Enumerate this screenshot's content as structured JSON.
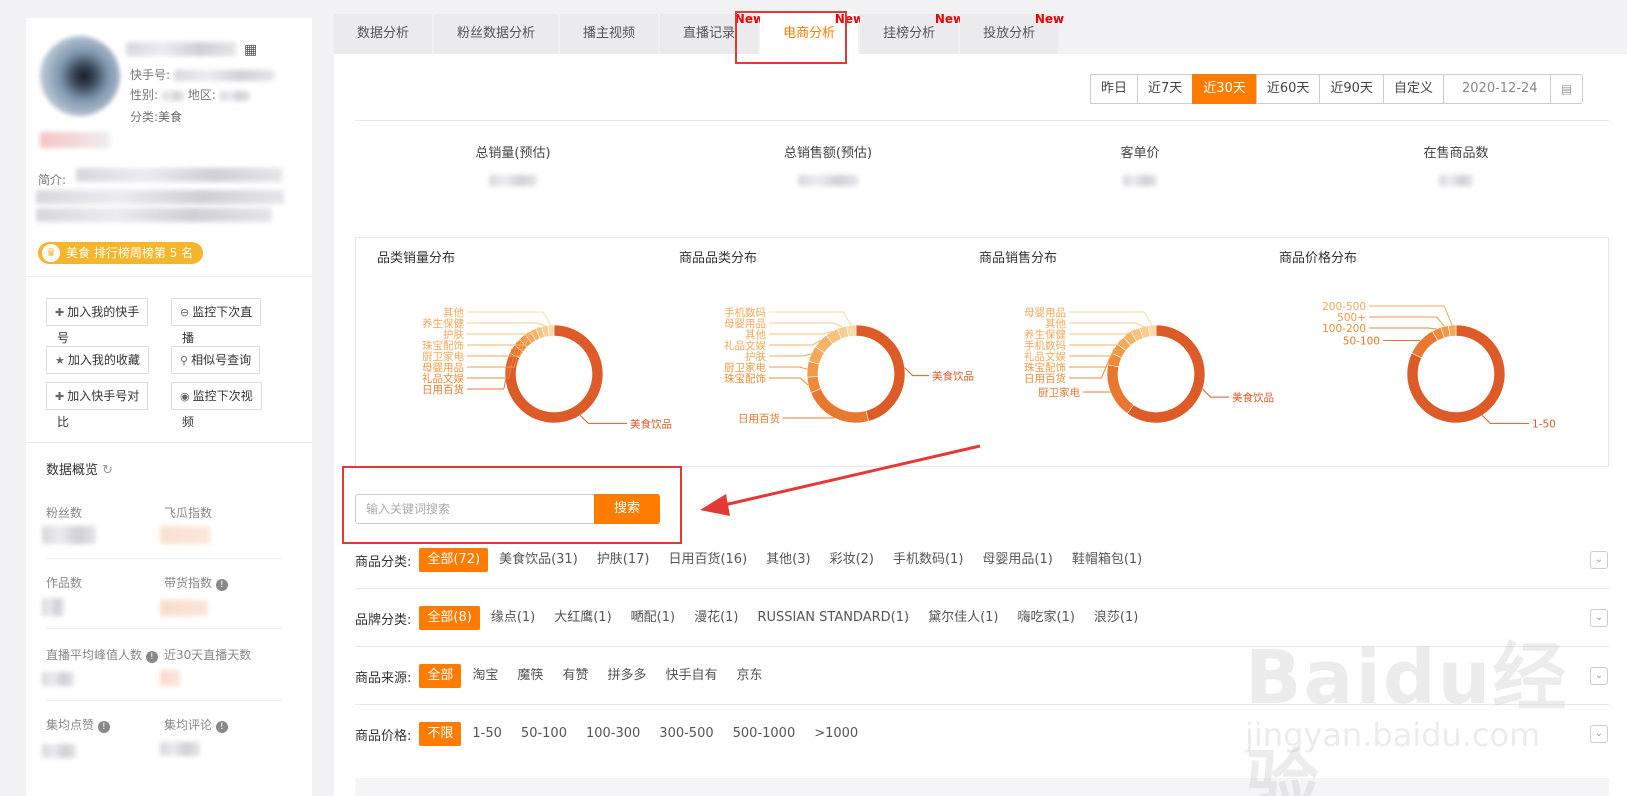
{
  "profile": {
    "kuaishou_label": "快手号:",
    "gender_label": "性别:",
    "region_label": "地区:",
    "category_label": "分类:",
    "category_value": "美食",
    "intro_label": "简介:",
    "rank_badge": "美食 排行榜周榜第 5 名"
  },
  "actions": [
    {
      "icon": "plus-icon",
      "label": "加入我的快手",
      "wrap": "号"
    },
    {
      "icon": "monitor-live-icon",
      "label": "监控下次直",
      "wrap": "播"
    },
    {
      "icon": "star-icon",
      "label": "加入我的收藏",
      "wrap": ""
    },
    {
      "icon": "search-icon",
      "label": "相似号查询",
      "wrap": ""
    },
    {
      "icon": "plus-icon",
      "label": "加入快手号对",
      "wrap": "比"
    },
    {
      "icon": "eye-icon",
      "label": "监控下次视",
      "wrap": "频"
    }
  ],
  "overview": {
    "title": "数据概览",
    "stats": [
      "粉丝数",
      "飞瓜指数",
      "作品数",
      "带货指数",
      "直播平均峰值人数",
      "近30天直播天数",
      "集均点赞",
      "集均评论"
    ]
  },
  "tabs": [
    {
      "label": "数据分析",
      "new": ""
    },
    {
      "label": "粉丝数据分析",
      "new": ""
    },
    {
      "label": "播主视频",
      "new": ""
    },
    {
      "label": "直播记录",
      "new": "New"
    },
    {
      "label": "电商分析",
      "new": "New"
    },
    {
      "label": "挂榜分析",
      "new": "New"
    },
    {
      "label": "投放分析",
      "new": "New"
    }
  ],
  "date_range": {
    "options": [
      "昨日",
      "近7天",
      "近30天",
      "近60天",
      "近90天",
      "自定义"
    ],
    "selected": "近30天",
    "date_value": "2020-12-24"
  },
  "metrics": [
    "总销量(预估)",
    "总销售额(预估)",
    "客单价",
    "在售商品数"
  ],
  "chart_data": [
    {
      "type": "pie",
      "title": "品类销量分布",
      "labels": [
        "美食饮品",
        "日用百货",
        "礼品文娱",
        "母婴用品",
        "厨卫家电",
        "珠宝配饰",
        "护肤",
        "养生保健",
        "其他"
      ],
      "values": [
        82,
        3,
        2.5,
        2.5,
        2,
        2,
        2,
        2,
        2
      ]
    },
    {
      "type": "pie",
      "title": "商品品类分布",
      "labels": [
        "美食饮品",
        "日用百货",
        "珠宝配饰",
        "厨卫家电",
        "护肤",
        "礼品文娱",
        "其他",
        "母婴用品",
        "手机数码"
      ],
      "values": [
        44,
        22,
        5,
        5,
        5,
        5,
        4,
        3,
        3
      ]
    },
    {
      "type": "pie",
      "title": "商品销售分布",
      "labels": [
        "美食饮品",
        "厨卫家电",
        "日用百货",
        "珠宝配饰",
        "礼品文娱",
        "手机数码",
        "养生保健",
        "其他",
        "母婴用品"
      ],
      "values": [
        60,
        18,
        4,
        3.5,
        3,
        3,
        3,
        3,
        2.5
      ]
    },
    {
      "type": "pie",
      "title": "商品价格分布",
      "labels": [
        "1-50",
        "50-100",
        "100-200",
        "500+",
        "200-500"
      ],
      "values": [
        82,
        10,
        3,
        2.5,
        2.5
      ]
    }
  ],
  "search": {
    "placeholder": "输入关键词搜索",
    "button": "搜索"
  },
  "filters": [
    {
      "label": "商品分类:",
      "options": [
        "全部(72)",
        "美食饮品(31)",
        "护肤(17)",
        "日用百货(16)",
        "其他(3)",
        "彩妆(2)",
        "手机数码(1)",
        "母婴用品(1)",
        "鞋帽箱包(1)"
      ]
    },
    {
      "label": "品牌分类:",
      "options": [
        "全部(8)",
        "缘点(1)",
        "大红鹰(1)",
        "嗮配(1)",
        "漫花(1)",
        "RUSSIAN STANDARD(1)",
        "黛尔佳人(1)",
        "嗨吃家(1)",
        "浪莎(1)"
      ]
    },
    {
      "label": "商品来源:",
      "options": [
        "全部",
        "淘宝",
        "魔筷",
        "有赞",
        "拼多多",
        "快手自有",
        "京东"
      ]
    },
    {
      "label": "商品价格:",
      "options": [
        "不限",
        "1-50",
        "50-100",
        "100-300",
        "300-500",
        "500-1000",
        ">1000"
      ]
    }
  ],
  "watermark": {
    "brand": "Baidu经验",
    "url": "jingyan.baidu.com"
  },
  "colors": {
    "accent": "#ff7c00",
    "highlight": "#e53935",
    "donut": "#dd5c2a"
  }
}
